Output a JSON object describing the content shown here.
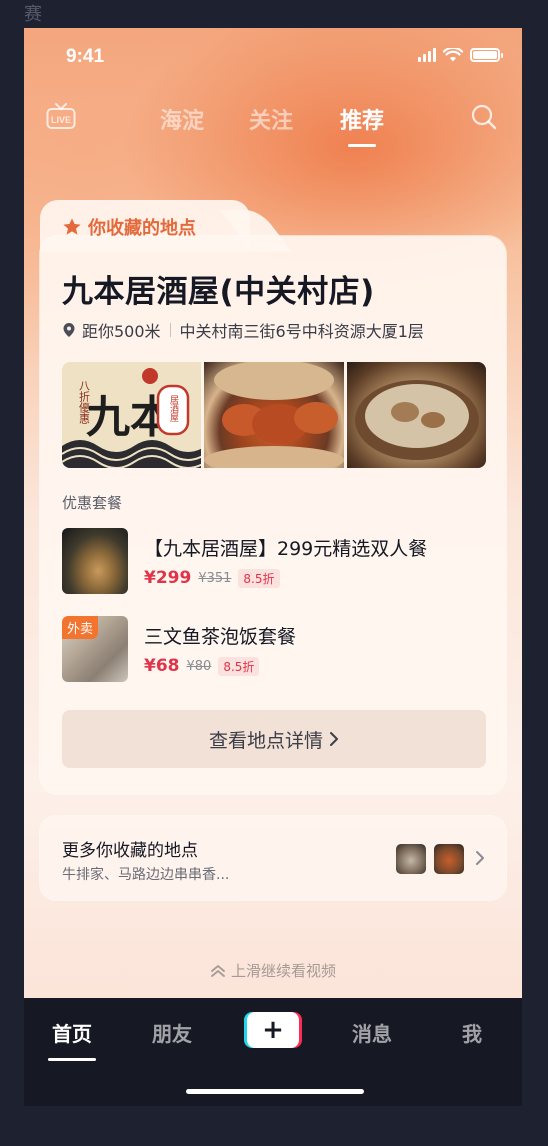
{
  "corner_glyph": "赛",
  "status_bar": {
    "time": "9:41"
  },
  "top_nav": {
    "live_label": "LIVE",
    "tabs": [
      {
        "label": "海淀",
        "active": false
      },
      {
        "label": "关注",
        "active": false
      },
      {
        "label": "推荐",
        "active": true
      }
    ]
  },
  "card": {
    "header": "你收藏的地点",
    "name": "九本居酒屋(中关村店)",
    "distance": "距你500米",
    "address": "中关村南三街6号中科资源大厦1层",
    "photo1_texts": {
      "side": "八折優惠",
      "main": "九本",
      "lantern": "居酒屋"
    },
    "deals_title": "优惠套餐",
    "deals": [
      {
        "title": "【九本居酒屋】299元精选双人餐",
        "price": "¥299",
        "original": "¥351",
        "discount": "8.5折",
        "badge": ""
      },
      {
        "title": "三文鱼茶泡饭套餐",
        "price": "¥68",
        "original": "¥80",
        "discount": "8.5折",
        "badge": "外卖"
      }
    ],
    "detail_button": "查看地点详情"
  },
  "more_places": {
    "title": "更多你收藏的地点",
    "subtitle": "牛排家、马路边边串串香..."
  },
  "swipe_hint": "上滑继续看视频",
  "bottom_nav": [
    {
      "label": "首页",
      "active": true
    },
    {
      "label": "朋友",
      "active": false
    },
    {
      "label": "消息",
      "active": false
    },
    {
      "label": "我",
      "active": false
    }
  ],
  "plus_label": "+",
  "colors": {
    "accent_orange": "#e26a3c",
    "price_red": "#e0344a",
    "tab_bar": "#161823"
  }
}
